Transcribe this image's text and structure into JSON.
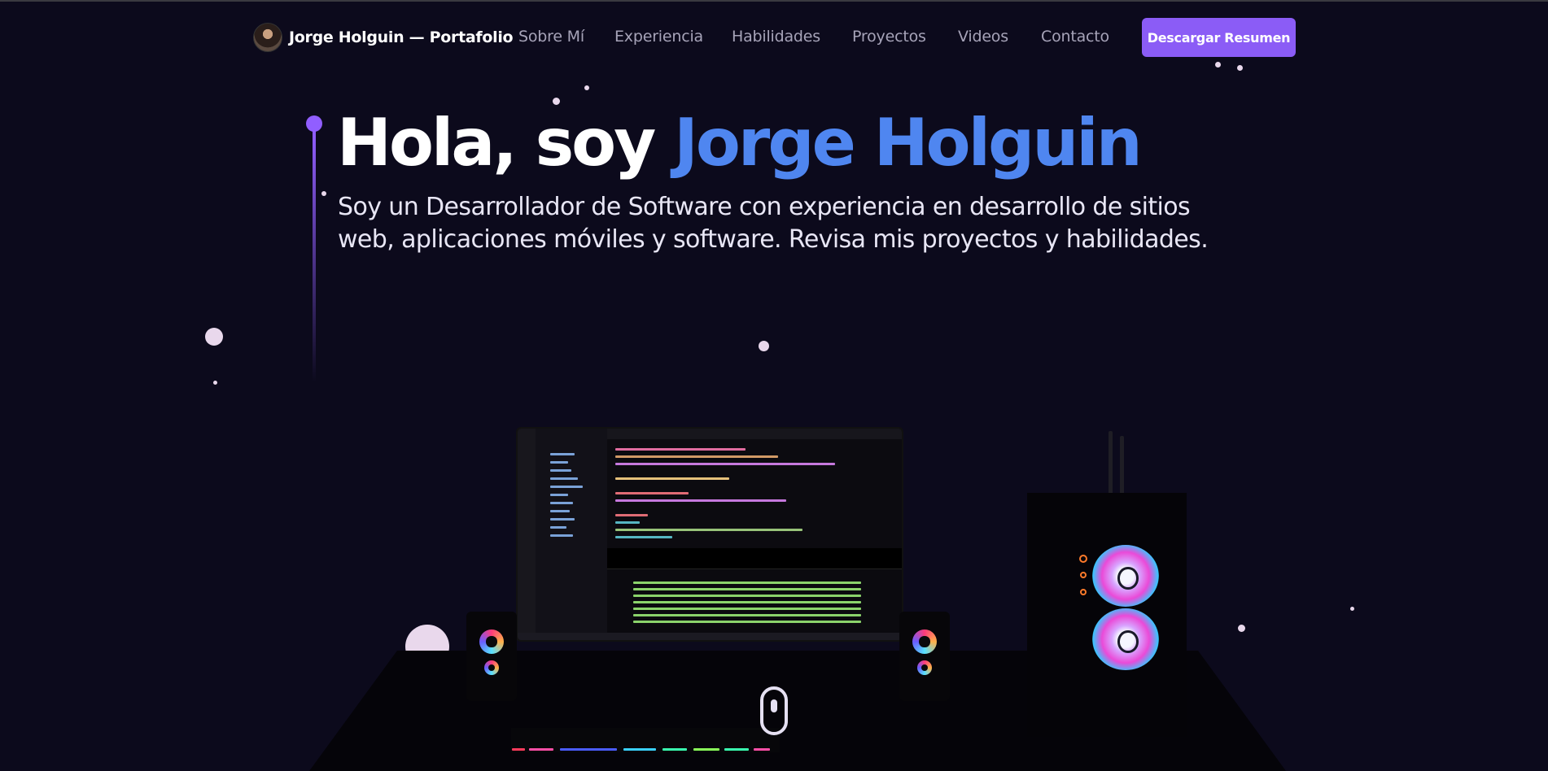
{
  "nav": {
    "brand": "Jorge Holguin — Portafolio",
    "links": [
      "Sobre Mí",
      "Experiencia",
      "Habilidades",
      "Proyectos",
      "Videos",
      "Contacto"
    ],
    "cta": "Descargar Resumen"
  },
  "hero": {
    "greeting": "Hola, soy",
    "name": "Jorge Holguin",
    "subtitle": "Soy un Desarrollador de Software con experiencia en desarrollo de sitios web, aplicaciones móviles y software. Revisa mis proyectos y habilidades."
  },
  "colors": {
    "background": "#0c0a1c",
    "accent_purple": "#915eff",
    "name_blue": "#4f86f0",
    "button": "#8b5cf6",
    "nav_link": "#a6a3b8"
  },
  "scene": {
    "icons": [
      "avatar-photo",
      "desktop-computer-3d",
      "speaker",
      "pc-case",
      "keyboard",
      "mouse"
    ]
  }
}
